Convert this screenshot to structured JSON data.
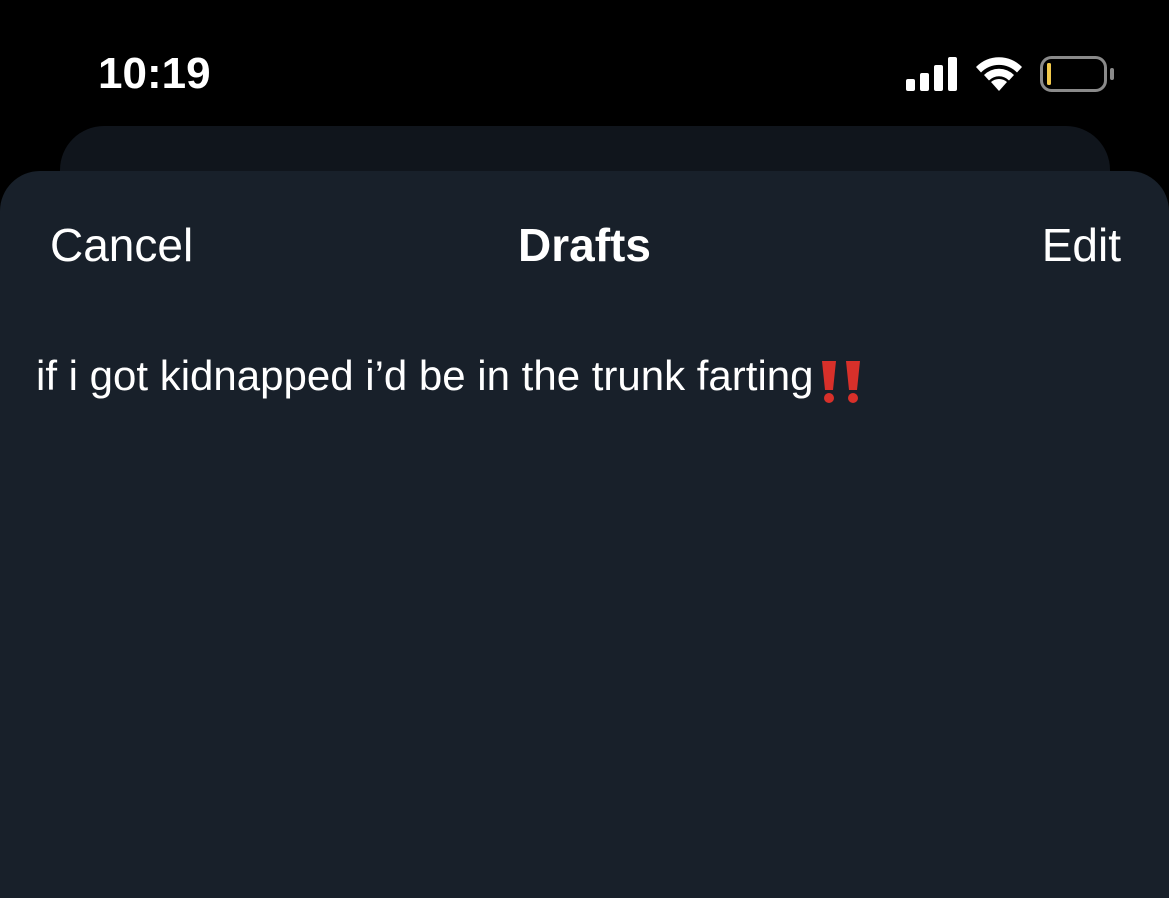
{
  "status_bar": {
    "time": "10:19",
    "icons": [
      "cellular-signal-icon",
      "wifi-icon",
      "battery-low-icon"
    ]
  },
  "nav": {
    "cancel_label": "Cancel",
    "title": "Drafts",
    "edit_label": "Edit"
  },
  "drafts": [
    {
      "text": "if i got kidnapped i’d be in the trunk farting",
      "emoji_icon": "double-exclamation-icon"
    }
  ],
  "colors": {
    "background": "#000000",
    "sheet": "#18202a",
    "text": "#ffffff",
    "emoji_red": "#d8302a",
    "battery_low": "#f2c94c"
  }
}
